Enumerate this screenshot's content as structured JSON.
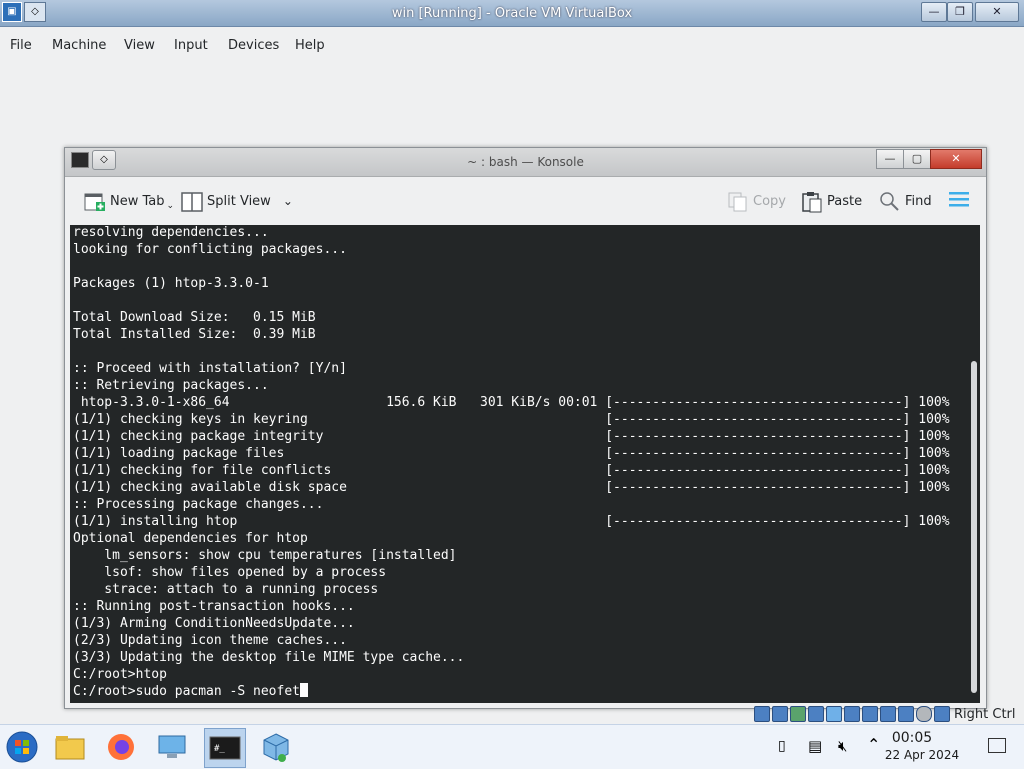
{
  "vbox": {
    "title": "win [Running] - Oracle VM VirtualBox",
    "menu": [
      "File",
      "Machine",
      "View",
      "Input",
      "Devices",
      "Help"
    ],
    "status_right": "Right Ctrl"
  },
  "konsole": {
    "title": "~ : bash — Konsole",
    "toolbar": {
      "new_tab": "New Tab",
      "split_view": "Split View",
      "copy": "Copy",
      "paste": "Paste",
      "find": "Find"
    },
    "terminal_lines": [
      "resolving dependencies...",
      "looking for conflicting packages...",
      "",
      "Packages (1) htop-3.3.0-1",
      "",
      "Total Download Size:   0.15 MiB",
      "Total Installed Size:  0.39 MiB",
      "",
      ":: Proceed with installation? [Y/n]",
      ":: Retrieving packages...",
      " htop-3.3.0-1-x86_64                    156.6 KiB   301 KiB/s 00:01 [-------------------------------------] 100%",
      "(1/1) checking keys in keyring                                      [-------------------------------------] 100%",
      "(1/1) checking package integrity                                    [-------------------------------------] 100%",
      "(1/1) loading package files                                         [-------------------------------------] 100%",
      "(1/1) checking for file conflicts                                   [-------------------------------------] 100%",
      "(1/1) checking available disk space                                 [-------------------------------------] 100%",
      ":: Processing package changes...",
      "(1/1) installing htop                                               [-------------------------------------] 100%",
      "Optional dependencies for htop",
      "    lm_sensors: show cpu temperatures [installed]",
      "    lsof: show files opened by a process",
      "    strace: attach to a running process",
      ":: Running post-transaction hooks...",
      "(1/3) Arming ConditionNeedsUpdate...",
      "(2/3) Updating icon theme caches...",
      "(3/3) Updating the desktop file MIME type cache...",
      "C:/root>htop",
      "C:/root>sudo pacman -S neofet"
    ]
  },
  "taskbar": {
    "time": "00:05",
    "date": "22 Apr 2024"
  },
  "colors": {
    "terminal_bg": "#232627",
    "terminal_fg": "#fcfcfc",
    "toolbar_accent": "#3daee9"
  }
}
